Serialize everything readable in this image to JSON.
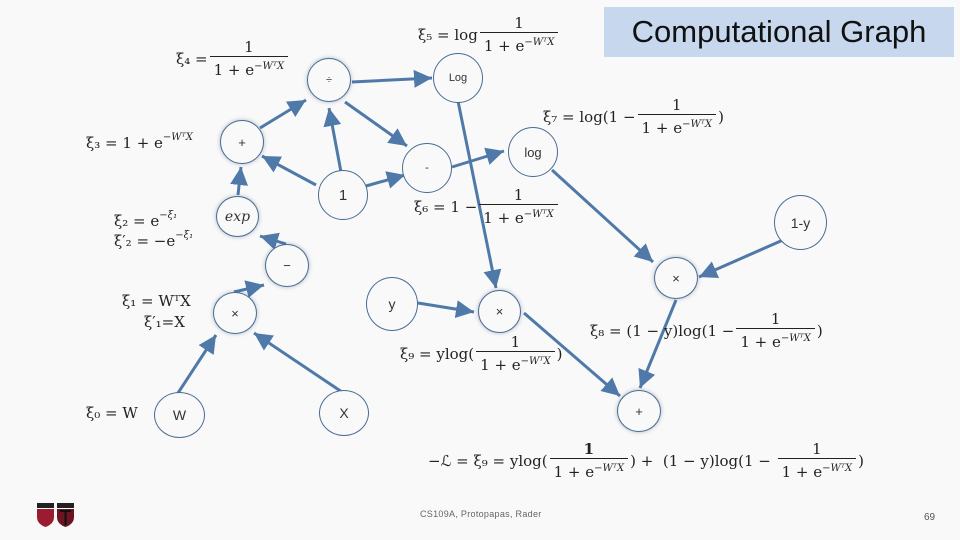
{
  "title": "Computational Graph",
  "nodes": {
    "div": "÷",
    "log_upper": "Log",
    "plus_top": "+",
    "minus_center": "-",
    "log_lower": "log",
    "one": "1",
    "exp": "exp",
    "one_minus_y": "1-y",
    "neg": "−",
    "times_right": "×",
    "y": "y",
    "times_center": "×",
    "times_left": "×",
    "w": "W",
    "x": "X",
    "plus_bottom": "+"
  },
  "equations": {
    "xi4": {
      "lhs": "ξ₄ = ",
      "num": "1",
      "den": "1 + e",
      "exp": "−WᵀX"
    },
    "xi5": {
      "lhs": "ξ₅ = log",
      "num": "1",
      "den": "1 + e",
      "exp": "−WᵀX"
    },
    "xi7": {
      "lhs": "ξ₇ = log(1 − ",
      "num": "1",
      "den": "1 + e",
      "exp": "−WᵀX",
      "rhs": ")"
    },
    "xi3": {
      "text": "ξ₃ = 1 + e",
      "exp": "−WᵀX"
    },
    "xi6": {
      "lhs": "ξ₆ = 1 − ",
      "num": "1",
      "den": "1 + e",
      "exp": "−WᵀX"
    },
    "xi2": {
      "text": "ξ₂ = e",
      "exp": "−ξ₁"
    },
    "xi2p": {
      "text": "ξ′₂ = −e",
      "exp": "−ξ₁"
    },
    "xi1": {
      "text": "ξ₁ = WᵀX"
    },
    "xi1p": {
      "text": "ξ′₁=X"
    },
    "xi0": {
      "text": "ξ₀ = W"
    },
    "xi8": {
      "lhs": "ξ₈ = (1 − y)log(1 − ",
      "num": "1",
      "den": "1 + e",
      "exp": "−WᵀX",
      "rhs": ")"
    },
    "xi9": {
      "lhs": "ξ₉ = ylog(",
      "num": "1",
      "den": "1 + e",
      "exp": "−WᵀX",
      "rhs": ")"
    },
    "loss": {
      "lhs": "−ℒ = ξ₉ = ylog(",
      "num1": "1",
      "den1": "1 + e",
      "exp1": "−WᵀX",
      "mid": ") +  (1 − y)log(1 − ",
      "num2": "1",
      "den2": "1 + e",
      "exp2": "−WᵀX",
      "rhs": ")"
    }
  },
  "footer": {
    "course": "CS109A, Protopapas, Rader",
    "page": "69"
  },
  "colors": {
    "title_bg": "#c7d8ee",
    "edge": "#4f79a8",
    "node_border": "#4a6c93",
    "background": "#f9f9f9"
  }
}
